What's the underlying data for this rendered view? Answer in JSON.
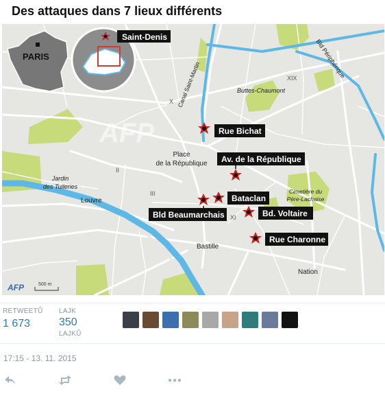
{
  "title": "Des attaques dans 7 lieux différents",
  "map": {
    "inset_country_label": "PARIS",
    "inset_marker_label": "Saint-Denis",
    "places": {
      "peripherique": "Bld Périphérique",
      "arr_xix": "XIX",
      "buttes": "Buttes-Chaumont",
      "arr_x": "X",
      "canal": "Canal Saint-Martin",
      "place_rep_1": "Place",
      "place_rep_2": "de la République",
      "tuileries_1": "Jardin",
      "tuileries_2": "des Tuileries",
      "arr_ii": "II",
      "louvre": "Louvre",
      "arr_iii": "III",
      "arr_xi": "XI",
      "bastille": "Bastille",
      "nation": "Nation",
      "cemetery_1": "Cimetière du",
      "cemetery_2": "Père-Lachaise"
    },
    "attacks": [
      "Rue Bichat",
      "Av. de la République",
      "Bataclan",
      "Bld Beaumarchais",
      "Bd. Voltaire",
      "Rue Charonne"
    ],
    "logo": "AFP",
    "scale_label": "500 m",
    "watermark": "AFP"
  },
  "tweet": {
    "retweets_label": "RETWEETŮ",
    "retweets_value": "1 673",
    "likes_label_1": "LAJK",
    "likes_label_2": "LAJKŮ",
    "likes_value": "350",
    "timestamp": "17:15 - 13. 11. 2015",
    "avatars": [
      "avatar-1",
      "avatar-2",
      "avatar-3",
      "avatar-4",
      "avatar-5",
      "avatar-6",
      "avatar-7",
      "avatar-8",
      "avatar-9"
    ],
    "actions": [
      "reply-icon",
      "retweet-icon",
      "like-icon",
      "more-icon"
    ]
  },
  "colors": {
    "map_bg": "#e6e6e3",
    "river": "#5eb8e6",
    "park": "#c8db7a",
    "roads": "#ffffff",
    "label_bg": "#111111",
    "marker": "#cc1f1f",
    "link": "#2b7bb9",
    "muted": "#8899a6"
  }
}
